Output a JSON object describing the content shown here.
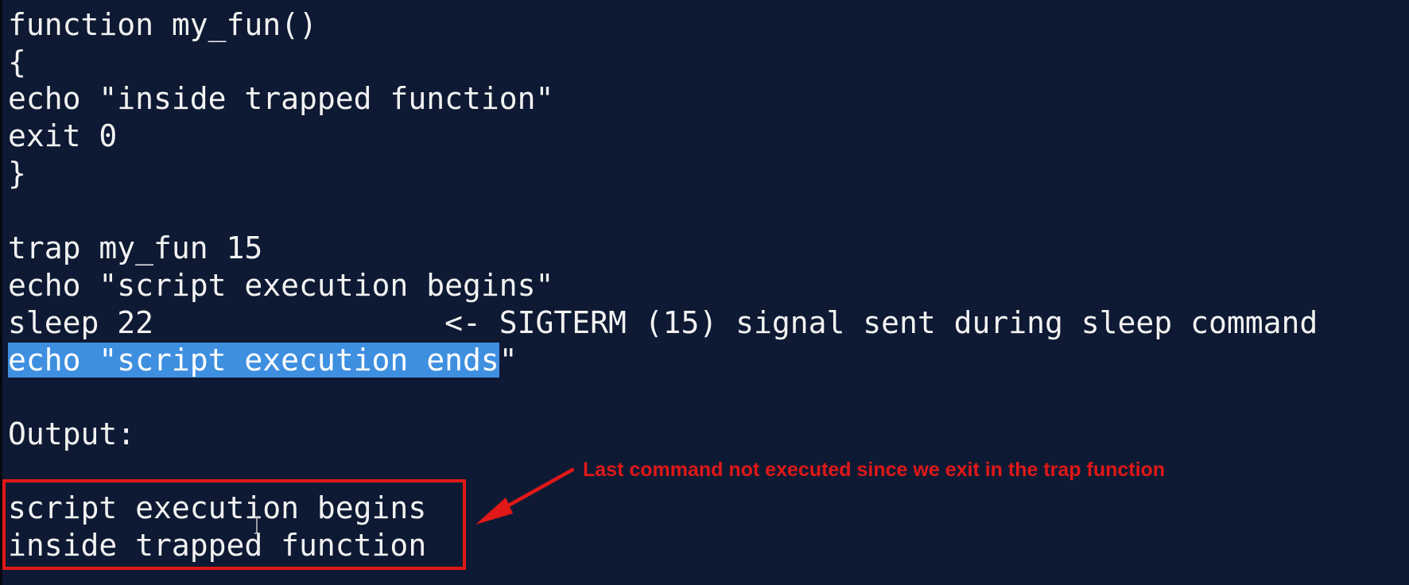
{
  "code_lines": [
    "function my_fun()",
    "{",
    "echo \"inside trapped function\"",
    "exit 0",
    "}",
    "",
    "trap my_fun 15",
    "echo \"script execution begins\"",
    "sleep 22                <- SIGTERM (15) signal sent during sleep command"
  ],
  "selected_line": {
    "selected_text": "echo \"script execution ends",
    "rest_text": "\""
  },
  "output_label": "Output:",
  "output_lines": [
    "script execution begins",
    "inside trapped function"
  ],
  "annotation": "Last command not executed since we exit in the trap function",
  "colors": {
    "background": "#0e1a33",
    "text": "#f2f2f2",
    "selection": "#3f8fe0",
    "annotation": "#e01818"
  }
}
